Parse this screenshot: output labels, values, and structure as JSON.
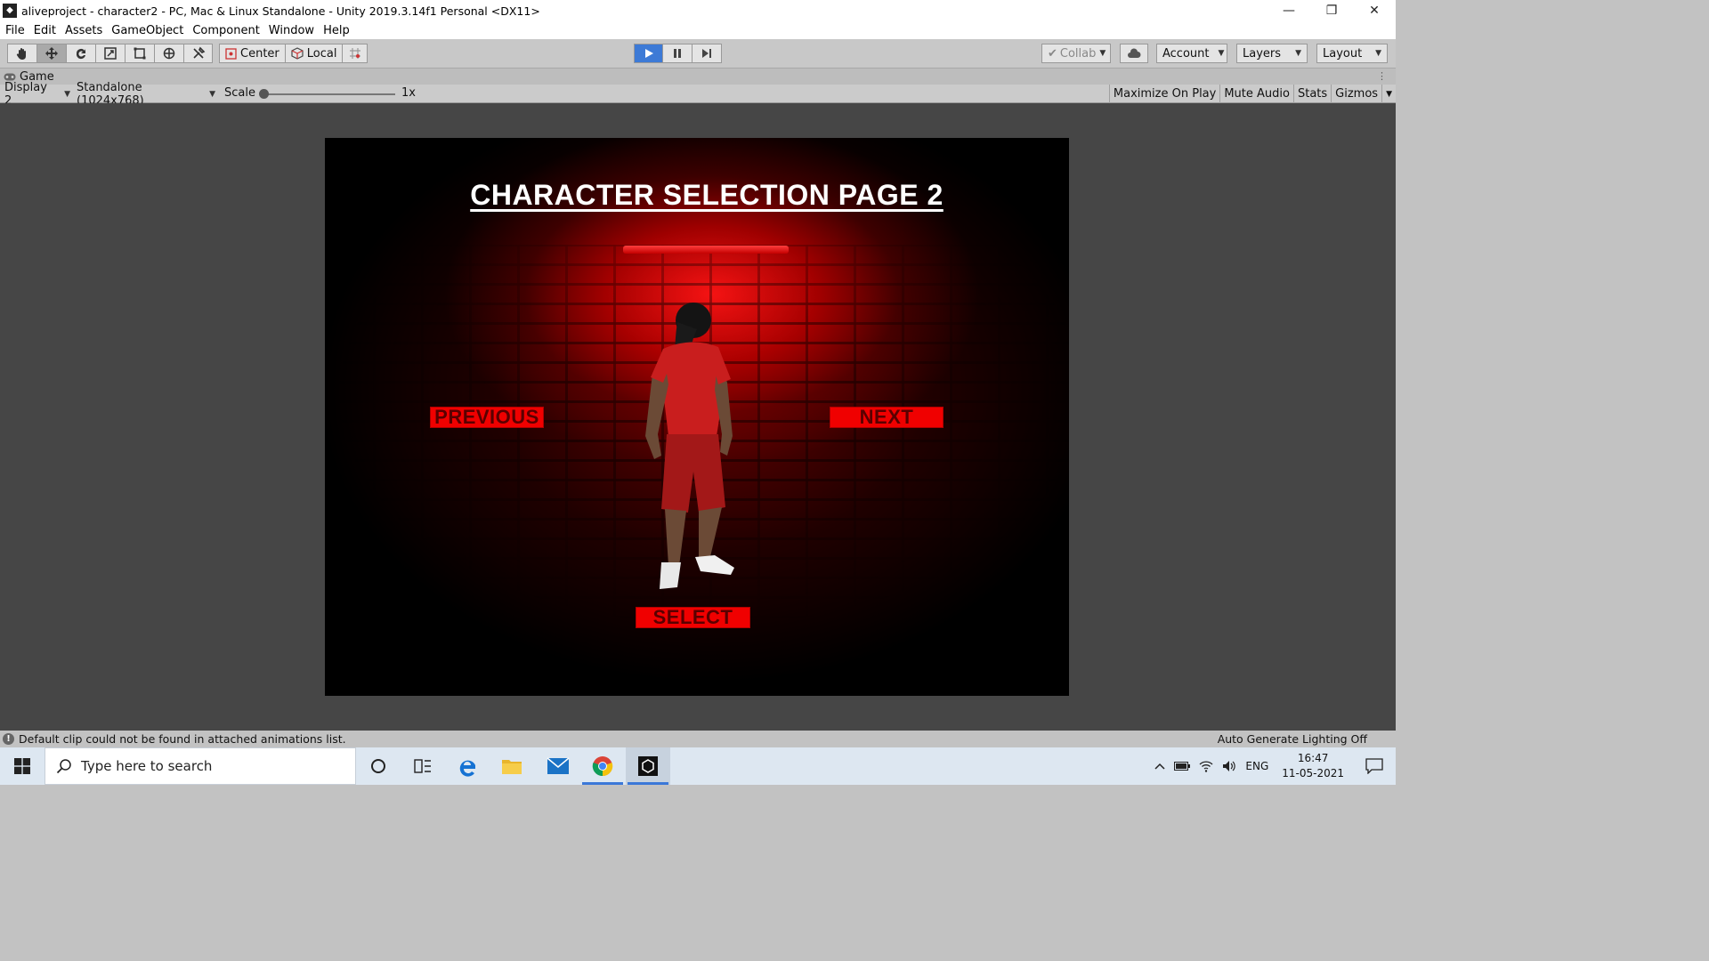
{
  "window": {
    "title": "aliveproject - character2 - PC, Mac & Linux Standalone - Unity 2019.3.14f1 Personal <DX11>"
  },
  "menu": [
    "File",
    "Edit",
    "Assets",
    "GameObject",
    "Component",
    "Window",
    "Help"
  ],
  "toolbar": {
    "pivot_label": "Center",
    "space_label": "Local",
    "collab_label": "Collab",
    "account_label": "Account",
    "layers_label": "Layers",
    "layout_label": "Layout"
  },
  "game_tab": {
    "label": "Game"
  },
  "game_bar": {
    "display": "Display 2",
    "resolution": "Standalone (1024x768)",
    "scale_label": "Scale",
    "scale_value": "1x",
    "scale_level": 0,
    "maximize": "Maximize On Play",
    "mute": "Mute Audio",
    "stats": "Stats",
    "gizmos": "Gizmos"
  },
  "game": {
    "title": "CHARACTER SELECTION PAGE 2",
    "previous": "PREVIOUS",
    "next": "NEXT",
    "select": "SELECT"
  },
  "status": {
    "message": "Default clip could not be found in attached animations list.",
    "right": "Auto Generate Lighting Off"
  },
  "taskbar": {
    "search_placeholder": "Type here to search",
    "lang": "ENG",
    "time": "16:47",
    "date": "11-05-2021"
  },
  "colors": {
    "play_active": "#3d7ad6",
    "game_button": "#f00000",
    "game_button_text": "#5a0000",
    "editor_bg": "#464646"
  }
}
